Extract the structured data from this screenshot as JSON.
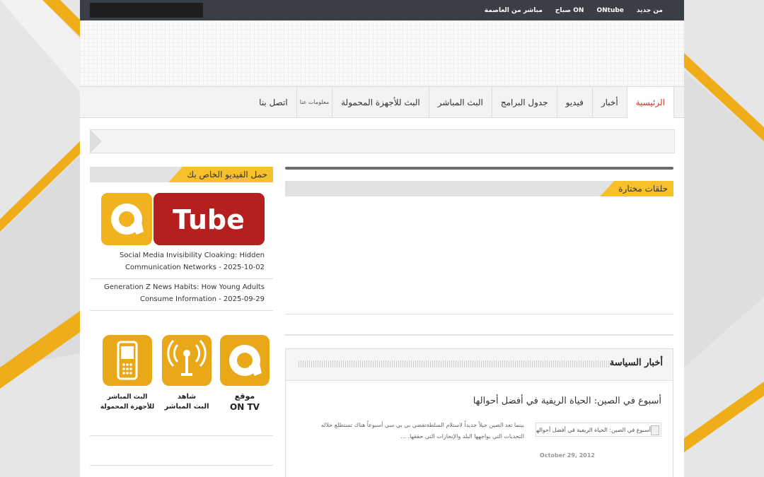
{
  "topbar": {
    "links": [
      "من جديد",
      "ONtube",
      "صباح ON",
      "مباشر من العاصمة"
    ]
  },
  "nav": {
    "items": [
      "الرئيسية",
      "أخبار",
      "فيديو",
      "جدول البرامج",
      "البث المباشر",
      "البث للأجهزة المحمولة",
      "معلومات عنا",
      "اتصل بنا"
    ]
  },
  "main": {
    "featured_title": "حلقات مختارة",
    "politics": {
      "title": "أخبار السياسة",
      "headline": "أسبوع في الصين: الحياة الريفية في أفضل أحوالها",
      "thumb_alt": "أسبوع في الصين: الحياة الريفية في أفضل أحوالها",
      "excerpt": "بينما تعد الصين جيلاً جديداً لاستلام السلطةتقضي بي بي سي أسبوعاً هناك تستطلع خلاله التحديات التي يواجهها البلد والإنجازات التي حققها. ...",
      "date": "October 29, 2012"
    }
  },
  "sidebar": {
    "title": "حمل الفيديو الخاص بك",
    "banner": {
      "label": "Tube"
    },
    "news": [
      {
        "text": "Social Media Invisibility Cloaking: Hidden Communication Networks - 2025-10-02"
      },
      {
        "text": "Generation Z News Habits: How Young Adults Consume Information - 2025-09-29"
      }
    ],
    "apps": [
      {
        "line1": "موقع",
        "line2": "ON TV",
        "icon": "on-logo-icon"
      },
      {
        "line1": "شاهد",
        "line2": "البث المباشر",
        "icon": "antenna-icon"
      },
      {
        "line1": "البث المباشر",
        "line2": "للأجهزة المحمولة",
        "icon": "mobile-phone-icon"
      }
    ]
  },
  "colors": {
    "accent": "#f5c02a",
    "orange": "#e8a317",
    "topbar": "#3a3f46",
    "tube_red": "#b5201f"
  }
}
